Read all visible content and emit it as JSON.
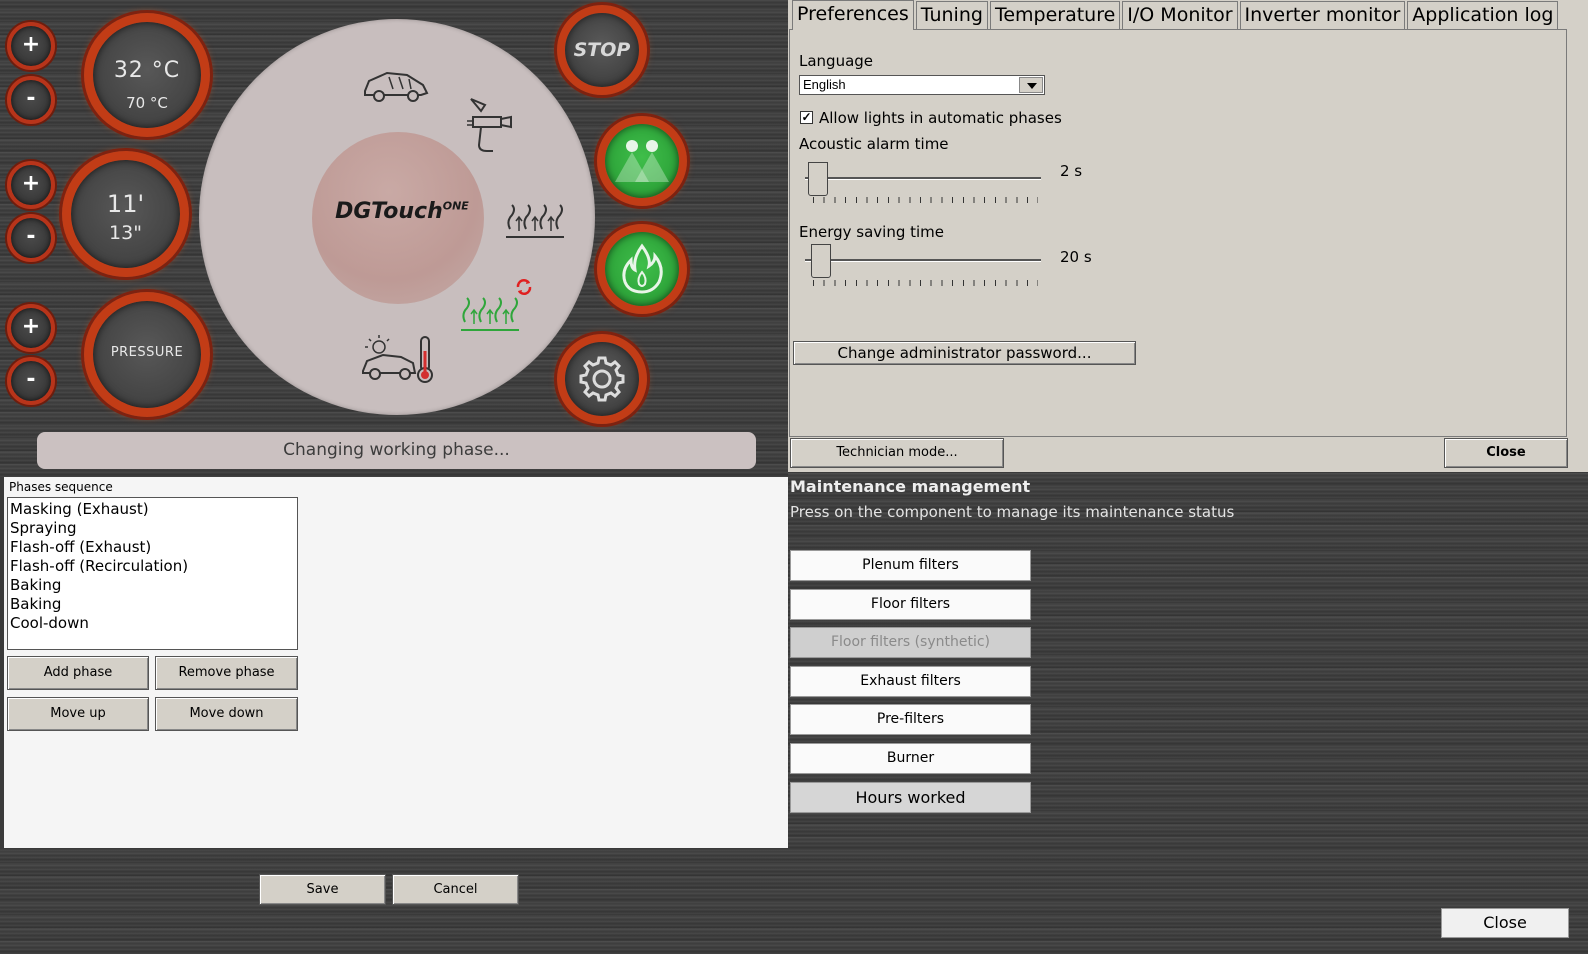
{
  "control_panel": {
    "temp_setpoint": "32 °C",
    "temp_secondary": "70 °C",
    "time_minutes": "11'",
    "time_seconds": "13\"",
    "pressure_label": "PRESSURE",
    "plus": "+",
    "minus": "-",
    "logo_main": "DGTouch",
    "logo_sup": "ONE",
    "stop_label": "STOP",
    "status_text": "Changing working phase...",
    "icons": [
      "car-masking-icon",
      "spray-gun-icon",
      "flash-off-exhaust-icon",
      "flash-off-recirculation-icon",
      "refresh-icon",
      "car-baking-icon",
      "spray-booth-icon",
      "flame-icon",
      "gear-icon"
    ],
    "colors": {
      "accent": "#c23c16",
      "green": "#2fa63b",
      "refresh_red": "#e02020"
    }
  },
  "prefs": {
    "tabs": [
      "Preferences",
      "Tuning",
      "Temperature",
      "I/O Monitor",
      "Inverter monitor",
      "Application log"
    ],
    "language_label": "Language",
    "language_value": "English",
    "lights_label": "Allow lights in automatic phases",
    "lights_checked": "✓",
    "alarm_label": "Acoustic alarm time",
    "alarm_value": "2 s",
    "energy_label": "Energy saving time",
    "energy_value": "20 s",
    "change_password": "Change administrator password...",
    "technician_mode": "Technician mode...",
    "close": "Close"
  },
  "phases": {
    "title": "Phases sequence",
    "items": [
      "Masking (Exhaust)",
      "Spraying",
      "Flash-off (Exhaust)",
      "Flash-off (Recirculation)",
      "Baking",
      "Baking",
      "Cool-down"
    ],
    "add_phase": "Add phase",
    "remove_phase": "Remove phase",
    "move_up": "Move up",
    "move_down": "Move down",
    "save": "Save",
    "cancel": "Cancel"
  },
  "maintenance": {
    "title": "Maintenance management",
    "subtitle": "Press on the component to manage its maintenance status",
    "buttons": [
      "Plenum filters",
      "Floor filters",
      "Floor filters (synthetic)",
      "Exhaust filters",
      "Pre-filters",
      "Burner",
      "Hours worked"
    ],
    "close": "Close"
  }
}
